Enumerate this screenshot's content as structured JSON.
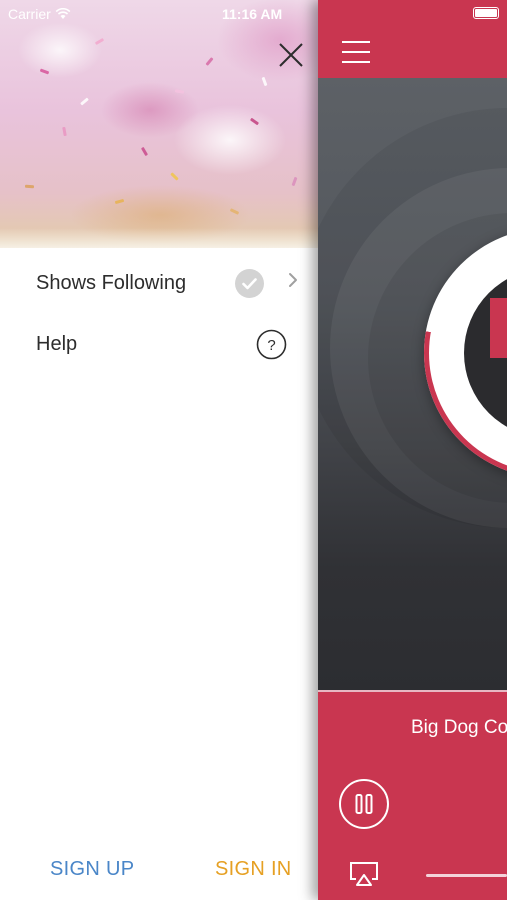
{
  "status_bar": {
    "carrier": "Carrier",
    "time": "11:16 AM"
  },
  "drawer": {
    "menu": [
      {
        "label": "Shows Following",
        "icon": "check-circle-icon",
        "accessory": "chevron-right-icon"
      },
      {
        "label": "Help",
        "icon": "question-circle-icon"
      }
    ],
    "sign_up": "SIGN UP",
    "sign_in": "SIGN IN",
    "close_icon": "close-icon"
  },
  "player": {
    "menu_icon": "hamburger-icon",
    "track_title": "Big Dog Co",
    "pause_icon": "pause-icon",
    "airplay_icon": "airplay-icon"
  },
  "colors": {
    "accent": "#c93650",
    "sign_up": "#4a86c8",
    "sign_in": "#e6a023",
    "text": "#2d2d2d"
  }
}
